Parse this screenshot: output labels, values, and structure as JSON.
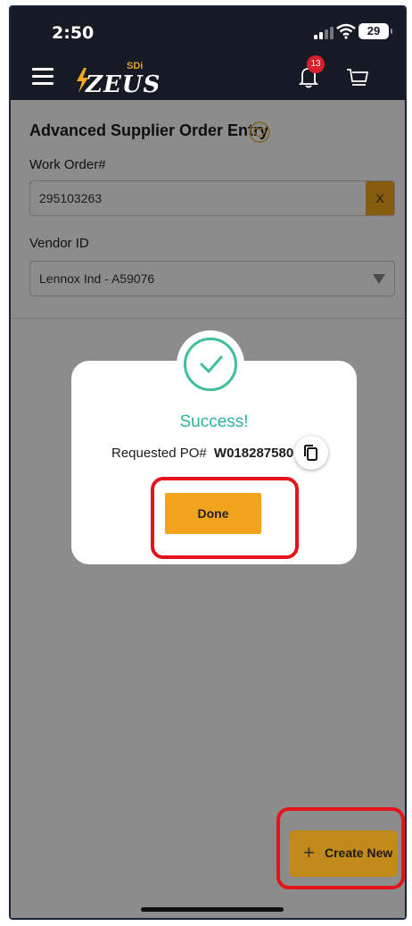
{
  "status": {
    "time": "2:50",
    "battery": "29"
  },
  "header": {
    "logo_text": "ZEUS",
    "logo_sub": "SDi",
    "notification_count": "13"
  },
  "form": {
    "title": "Advanced Supplier Order Entry",
    "work_order_label": "Work Order#",
    "work_order_value": "295103263",
    "clear_label": "X",
    "vendor_label": "Vendor ID",
    "vendor_value": "Lennox Ind - A59076"
  },
  "modal": {
    "title": "Success!",
    "po_label": "Requested PO#",
    "po_value": "W018287580",
    "done_label": "Done"
  },
  "fab": {
    "plus": "+",
    "label": "Create New"
  },
  "colors": {
    "accent": "#f4a41c",
    "success": "#2bb59a",
    "header": "#151a24",
    "highlight": "#e5141a"
  }
}
